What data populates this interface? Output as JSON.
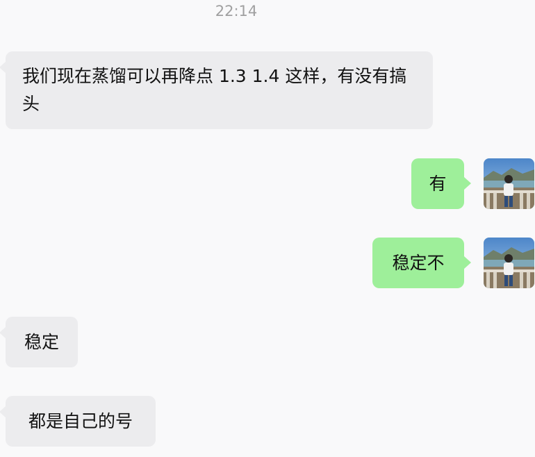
{
  "timestamp": "22:14",
  "messages": [
    {
      "id": "msg1",
      "side": "incoming",
      "text": "我们现在蒸馏可以再降点 1.3 1.4 这样，有没有搞头"
    },
    {
      "id": "msg2",
      "side": "outgoing",
      "text": "有"
    },
    {
      "id": "msg3",
      "side": "outgoing",
      "text": "稳定不"
    },
    {
      "id": "msg4",
      "side": "incoming",
      "text": "稳定"
    },
    {
      "id": "msg5",
      "side": "incoming",
      "text": "都是自己的号"
    }
  ],
  "avatar": {
    "icon": "user-photo-avatar-icon"
  },
  "colors": {
    "background": "#f9f9fa",
    "incoming_bubble": "#ececee",
    "outgoing_bubble": "#9eef9a",
    "timestamp_text": "#a0a0a0"
  }
}
